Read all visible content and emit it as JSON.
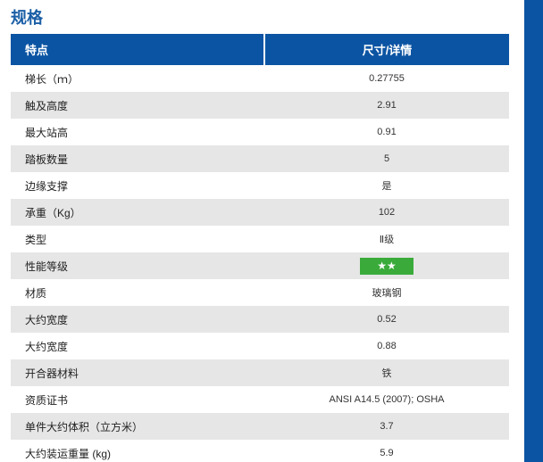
{
  "section_title": "规格",
  "table": {
    "headers": [
      "特点",
      "尺寸/详情"
    ],
    "rows": [
      {
        "feature": "梯长（ｍ）",
        "value": "0.27755"
      },
      {
        "feature": "触及高度",
        "value": "2.91"
      },
      {
        "feature": "最大站高",
        "value": "0.91"
      },
      {
        "feature": "踏板数量",
        "value": "5"
      },
      {
        "feature": "边缘支撑",
        "value": "是"
      },
      {
        "feature": "承重（Kg）",
        "value": "102"
      },
      {
        "feature": "类型",
        "value": "Ⅱ级"
      },
      {
        "feature": "性能等级",
        "value": "★★"
      },
      {
        "feature": "材质",
        "value": "玻璃钢"
      },
      {
        "feature": "大约宽度",
        "value": "0.52"
      },
      {
        "feature": "大约宽度",
        "value": "0.88"
      },
      {
        "feature": "开合器材料",
        "value": "铁"
      },
      {
        "feature": "资质证书",
        "value": "ANSI A14.5 (2007); OSHA"
      },
      {
        "feature": "单件大约体积（立方米）",
        "value": "3.7"
      },
      {
        "feature": "大约装运重量 (kg)",
        "value": "5.9"
      }
    ]
  },
  "colors": {
    "header_bg": "#0b54a3",
    "title": "#1a5ea6",
    "stripe": "#e6e6e6",
    "rating_bg": "#3aab3a"
  }
}
